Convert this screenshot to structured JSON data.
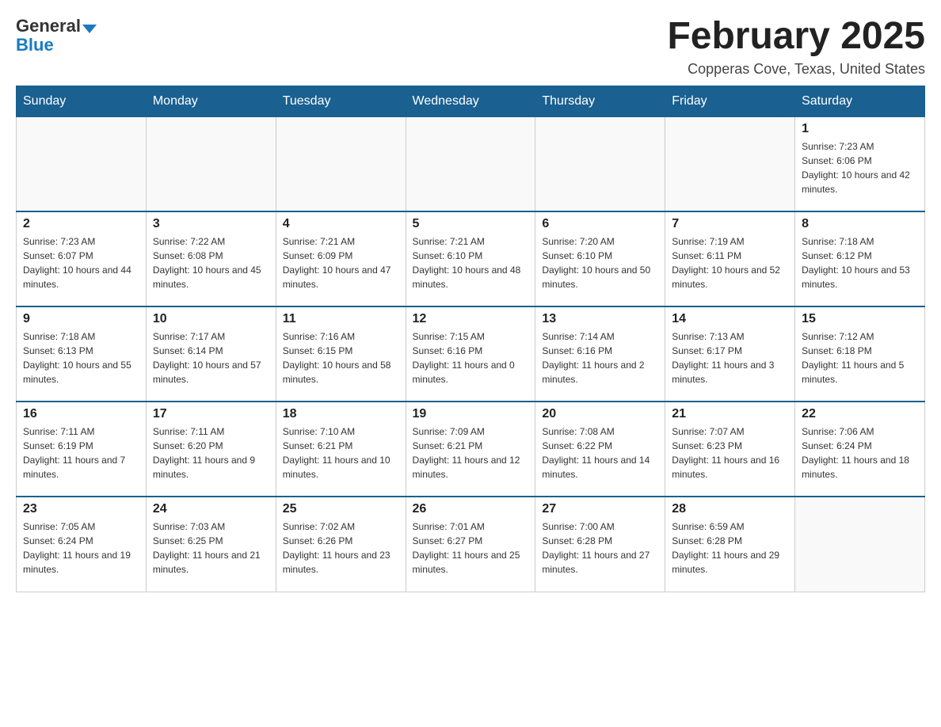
{
  "header": {
    "logo_general": "General",
    "logo_blue": "Blue",
    "title": "February 2025",
    "subtitle": "Copperas Cove, Texas, United States"
  },
  "days_of_week": [
    "Sunday",
    "Monday",
    "Tuesday",
    "Wednesday",
    "Thursday",
    "Friday",
    "Saturday"
  ],
  "weeks": [
    [
      {
        "day": "",
        "sunrise": "",
        "sunset": "",
        "daylight": ""
      },
      {
        "day": "",
        "sunrise": "",
        "sunset": "",
        "daylight": ""
      },
      {
        "day": "",
        "sunrise": "",
        "sunset": "",
        "daylight": ""
      },
      {
        "day": "",
        "sunrise": "",
        "sunset": "",
        "daylight": ""
      },
      {
        "day": "",
        "sunrise": "",
        "sunset": "",
        "daylight": ""
      },
      {
        "day": "",
        "sunrise": "",
        "sunset": "",
        "daylight": ""
      },
      {
        "day": "1",
        "sunrise": "Sunrise: 7:23 AM",
        "sunset": "Sunset: 6:06 PM",
        "daylight": "Daylight: 10 hours and 42 minutes."
      }
    ],
    [
      {
        "day": "2",
        "sunrise": "Sunrise: 7:23 AM",
        "sunset": "Sunset: 6:07 PM",
        "daylight": "Daylight: 10 hours and 44 minutes."
      },
      {
        "day": "3",
        "sunrise": "Sunrise: 7:22 AM",
        "sunset": "Sunset: 6:08 PM",
        "daylight": "Daylight: 10 hours and 45 minutes."
      },
      {
        "day": "4",
        "sunrise": "Sunrise: 7:21 AM",
        "sunset": "Sunset: 6:09 PM",
        "daylight": "Daylight: 10 hours and 47 minutes."
      },
      {
        "day": "5",
        "sunrise": "Sunrise: 7:21 AM",
        "sunset": "Sunset: 6:10 PM",
        "daylight": "Daylight: 10 hours and 48 minutes."
      },
      {
        "day": "6",
        "sunrise": "Sunrise: 7:20 AM",
        "sunset": "Sunset: 6:10 PM",
        "daylight": "Daylight: 10 hours and 50 minutes."
      },
      {
        "day": "7",
        "sunrise": "Sunrise: 7:19 AM",
        "sunset": "Sunset: 6:11 PM",
        "daylight": "Daylight: 10 hours and 52 minutes."
      },
      {
        "day": "8",
        "sunrise": "Sunrise: 7:18 AM",
        "sunset": "Sunset: 6:12 PM",
        "daylight": "Daylight: 10 hours and 53 minutes."
      }
    ],
    [
      {
        "day": "9",
        "sunrise": "Sunrise: 7:18 AM",
        "sunset": "Sunset: 6:13 PM",
        "daylight": "Daylight: 10 hours and 55 minutes."
      },
      {
        "day": "10",
        "sunrise": "Sunrise: 7:17 AM",
        "sunset": "Sunset: 6:14 PM",
        "daylight": "Daylight: 10 hours and 57 minutes."
      },
      {
        "day": "11",
        "sunrise": "Sunrise: 7:16 AM",
        "sunset": "Sunset: 6:15 PM",
        "daylight": "Daylight: 10 hours and 58 minutes."
      },
      {
        "day": "12",
        "sunrise": "Sunrise: 7:15 AM",
        "sunset": "Sunset: 6:16 PM",
        "daylight": "Daylight: 11 hours and 0 minutes."
      },
      {
        "day": "13",
        "sunrise": "Sunrise: 7:14 AM",
        "sunset": "Sunset: 6:16 PM",
        "daylight": "Daylight: 11 hours and 2 minutes."
      },
      {
        "day": "14",
        "sunrise": "Sunrise: 7:13 AM",
        "sunset": "Sunset: 6:17 PM",
        "daylight": "Daylight: 11 hours and 3 minutes."
      },
      {
        "day": "15",
        "sunrise": "Sunrise: 7:12 AM",
        "sunset": "Sunset: 6:18 PM",
        "daylight": "Daylight: 11 hours and 5 minutes."
      }
    ],
    [
      {
        "day": "16",
        "sunrise": "Sunrise: 7:11 AM",
        "sunset": "Sunset: 6:19 PM",
        "daylight": "Daylight: 11 hours and 7 minutes."
      },
      {
        "day": "17",
        "sunrise": "Sunrise: 7:11 AM",
        "sunset": "Sunset: 6:20 PM",
        "daylight": "Daylight: 11 hours and 9 minutes."
      },
      {
        "day": "18",
        "sunrise": "Sunrise: 7:10 AM",
        "sunset": "Sunset: 6:21 PM",
        "daylight": "Daylight: 11 hours and 10 minutes."
      },
      {
        "day": "19",
        "sunrise": "Sunrise: 7:09 AM",
        "sunset": "Sunset: 6:21 PM",
        "daylight": "Daylight: 11 hours and 12 minutes."
      },
      {
        "day": "20",
        "sunrise": "Sunrise: 7:08 AM",
        "sunset": "Sunset: 6:22 PM",
        "daylight": "Daylight: 11 hours and 14 minutes."
      },
      {
        "day": "21",
        "sunrise": "Sunrise: 7:07 AM",
        "sunset": "Sunset: 6:23 PM",
        "daylight": "Daylight: 11 hours and 16 minutes."
      },
      {
        "day": "22",
        "sunrise": "Sunrise: 7:06 AM",
        "sunset": "Sunset: 6:24 PM",
        "daylight": "Daylight: 11 hours and 18 minutes."
      }
    ],
    [
      {
        "day": "23",
        "sunrise": "Sunrise: 7:05 AM",
        "sunset": "Sunset: 6:24 PM",
        "daylight": "Daylight: 11 hours and 19 minutes."
      },
      {
        "day": "24",
        "sunrise": "Sunrise: 7:03 AM",
        "sunset": "Sunset: 6:25 PM",
        "daylight": "Daylight: 11 hours and 21 minutes."
      },
      {
        "day": "25",
        "sunrise": "Sunrise: 7:02 AM",
        "sunset": "Sunset: 6:26 PM",
        "daylight": "Daylight: 11 hours and 23 minutes."
      },
      {
        "day": "26",
        "sunrise": "Sunrise: 7:01 AM",
        "sunset": "Sunset: 6:27 PM",
        "daylight": "Daylight: 11 hours and 25 minutes."
      },
      {
        "day": "27",
        "sunrise": "Sunrise: 7:00 AM",
        "sunset": "Sunset: 6:28 PM",
        "daylight": "Daylight: 11 hours and 27 minutes."
      },
      {
        "day": "28",
        "sunrise": "Sunrise: 6:59 AM",
        "sunset": "Sunset: 6:28 PM",
        "daylight": "Daylight: 11 hours and 29 minutes."
      },
      {
        "day": "",
        "sunrise": "",
        "sunset": "",
        "daylight": ""
      }
    ]
  ]
}
